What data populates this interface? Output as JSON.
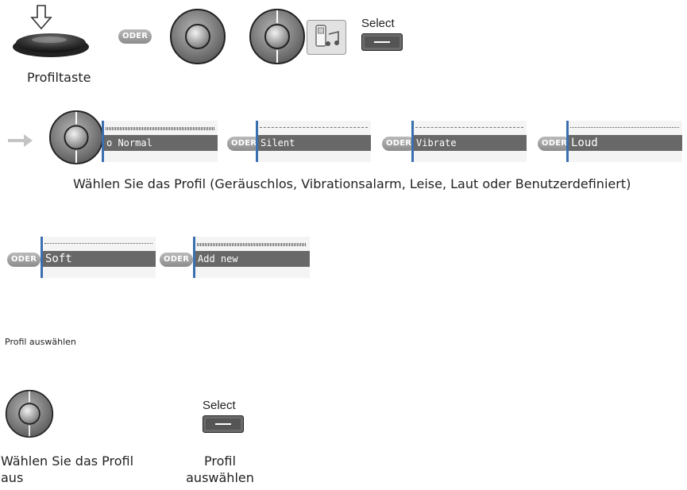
{
  "top_row": {
    "oder": "ODER",
    "select_label": "Select",
    "caption": "Profiltaste"
  },
  "profile_row": {
    "screens": [
      "o Normal",
      "Silent",
      "Vibrate",
      "Loud"
    ],
    "oder": "ODER",
    "caption": "Wählen Sie das Profil (Geräuschlos, Vibrationsalarm, Leise, Laut oder Benutzerdefiniert)"
  },
  "second_row": {
    "screens": [
      "Soft",
      "Add new"
    ],
    "oder": "ODER"
  },
  "section_label": "Profil auswählen",
  "bottom": {
    "left_caption": "Wählen Sie das Profil aus",
    "select_label": "Select",
    "right_caption": "Profil auswählen"
  },
  "icons": [
    "down-arrow-icon",
    "phone-device-icon",
    "nav-wheel-icon",
    "profile-music-icon",
    "right-arrow-icon",
    "select-key-icon"
  ]
}
